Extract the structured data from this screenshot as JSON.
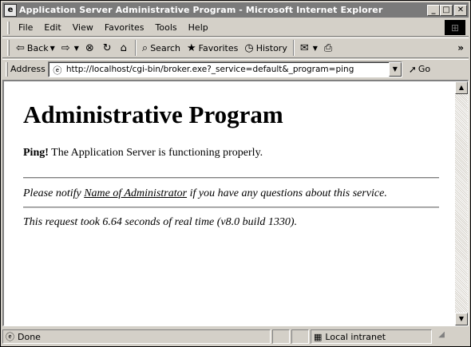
{
  "window": {
    "title": "Application Server Administrative Program - Microsoft Internet Explorer",
    "buttons": {
      "minimize": "_",
      "maximize": "□",
      "close": "✕"
    }
  },
  "menu": [
    "File",
    "Edit",
    "View",
    "Favorites",
    "Tools",
    "Help"
  ],
  "toolbar": {
    "back": "Back",
    "search": "Search",
    "favorites": "Favorites",
    "history": "History"
  },
  "address": {
    "label": "Address",
    "url": "http://localhost/cgi-bin/broker.exe?_service=default&_program=ping",
    "go": "Go"
  },
  "page": {
    "heading": "Administrative Program",
    "ping_bold": "Ping!",
    "ping_text": " The Application Server is functioning properly.",
    "notice_before": "Please notify ",
    "admin_link": "Name of Administrator",
    "notice_after": " if you have any questions about this service.",
    "timing": "This request took 6.64 seconds of real time (v8.0 build 1330)."
  },
  "status": {
    "text": "Done",
    "zone": "Local intranet"
  }
}
